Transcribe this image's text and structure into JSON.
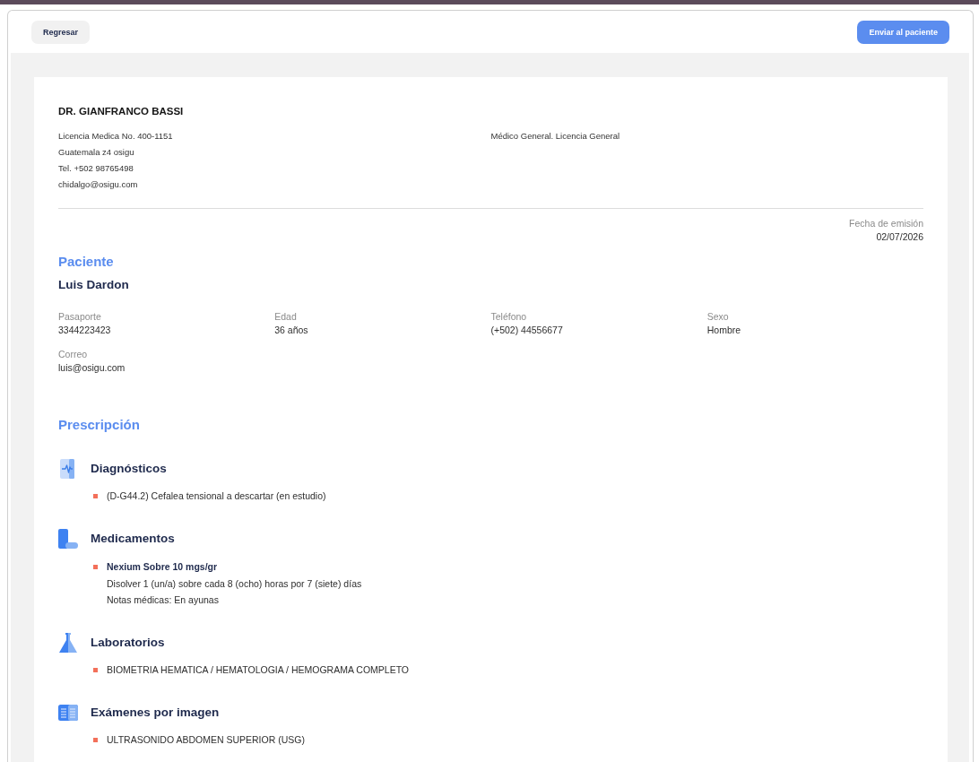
{
  "header": {
    "back_button": "Regresar",
    "send_button": "Enviar al paciente"
  },
  "doctor": {
    "name": "DR. GIANFRANCO BASSI",
    "details": [
      "Licencia Medica No. 400-1151",
      "Guatemala z4 osigu",
      "Tel. +502 98765498",
      "chidalgo@osigu.com"
    ],
    "specialty": "Médico General. Licencia General"
  },
  "issue_date": {
    "label": "Fecha de emisión",
    "value": "02/07/2026"
  },
  "patient": {
    "heading": "Paciente",
    "name": "Luis Dardon",
    "fields": [
      {
        "label": "Pasaporte",
        "value": "3344223423"
      },
      {
        "label": "Edad",
        "value": "36 años"
      },
      {
        "label": "Teléfono",
        "value": "(+502) 44556677"
      },
      {
        "label": "Sexo",
        "value": "Hombre"
      },
      {
        "label": "Correo",
        "value": "luis@osigu.com"
      }
    ]
  },
  "prescription": {
    "heading": "Prescripción",
    "sections": [
      {
        "kind": "diagnosis",
        "title": "Diagnósticos",
        "items": [
          {
            "text": "(D-G44.2) Cefalea tensional a descartar (en estudio)"
          }
        ]
      },
      {
        "kind": "medication",
        "title": "Medicamentos",
        "items": [
          {
            "name": "Nexium Sobre 10 mgs/gr",
            "lines": [
              "Disolver 1 (un/a) sobre cada 8 (ocho) horas por 7 (siete) días",
              "Notas médicas: En ayunas"
            ]
          }
        ]
      },
      {
        "kind": "lab",
        "title": "Laboratorios",
        "items": [
          {
            "text": "BIOMETRIA HEMATICA / HEMATOLOGIA / HEMOGRAMA COMPLETO"
          }
        ]
      },
      {
        "kind": "imaging",
        "title": "Exámenes por imagen",
        "items": [
          {
            "text": "ULTRASONIDO ABDOMEN SUPERIOR (USG)"
          }
        ]
      }
    ]
  }
}
